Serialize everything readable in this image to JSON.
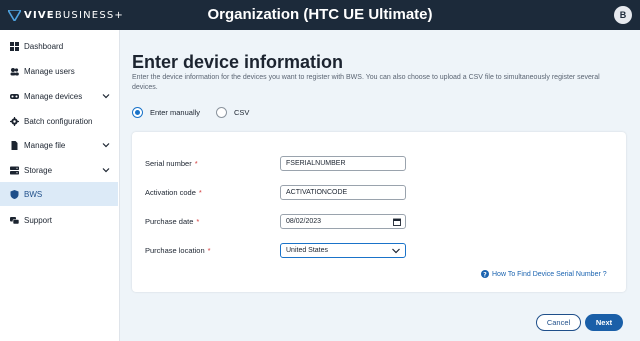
{
  "header": {
    "logo_bold": "VIVE",
    "logo_light": "BUSINESS+",
    "title": "Organization (HTC UE Ultimate)",
    "avatar_initial": "B"
  },
  "sidebar": {
    "items": [
      {
        "label": "Dashboard",
        "icon": "dashboard-icon"
      },
      {
        "label": "Manage users",
        "icon": "users-icon",
        "expandable": false
      },
      {
        "label": "Manage devices",
        "icon": "headset-icon",
        "expandable": true
      },
      {
        "label": "Batch configuration",
        "icon": "gear-icon"
      },
      {
        "label": "Manage file",
        "icon": "file-icon",
        "expandable": true
      },
      {
        "label": "Storage",
        "icon": "storage-icon",
        "expandable": true
      },
      {
        "label": "BWS",
        "icon": "shield-icon",
        "active": true
      },
      {
        "label": "Support",
        "icon": "support-icon"
      }
    ]
  },
  "main": {
    "heading": "Enter device information",
    "description": "Enter the device information for the devices you want to register with BWS. You can also choose to upload a CSV file to simultaneously register several devices.",
    "radio": {
      "manual_label": "Enter manually",
      "csv_label": "CSV",
      "selected": "manual"
    },
    "form": {
      "serial_label": "Serial number",
      "serial_value": "FSERIALNUMBER",
      "activation_label": "Activation code",
      "activation_value": "ACTIVATIONCODE",
      "date_label": "Purchase date",
      "date_value": "08/02/2023",
      "location_label": "Purchase location",
      "location_value": "United States",
      "required_mark": "*"
    },
    "help_link": "How To Find Device Serial Number ?",
    "cancel_label": "Cancel",
    "next_label": "Next"
  },
  "colors": {
    "topbar": "#1c2a3a",
    "accent": "#1a73c9",
    "primary_button": "#1a5fa8",
    "active_nav_bg": "#dceaf7",
    "background": "#eef4f9"
  }
}
